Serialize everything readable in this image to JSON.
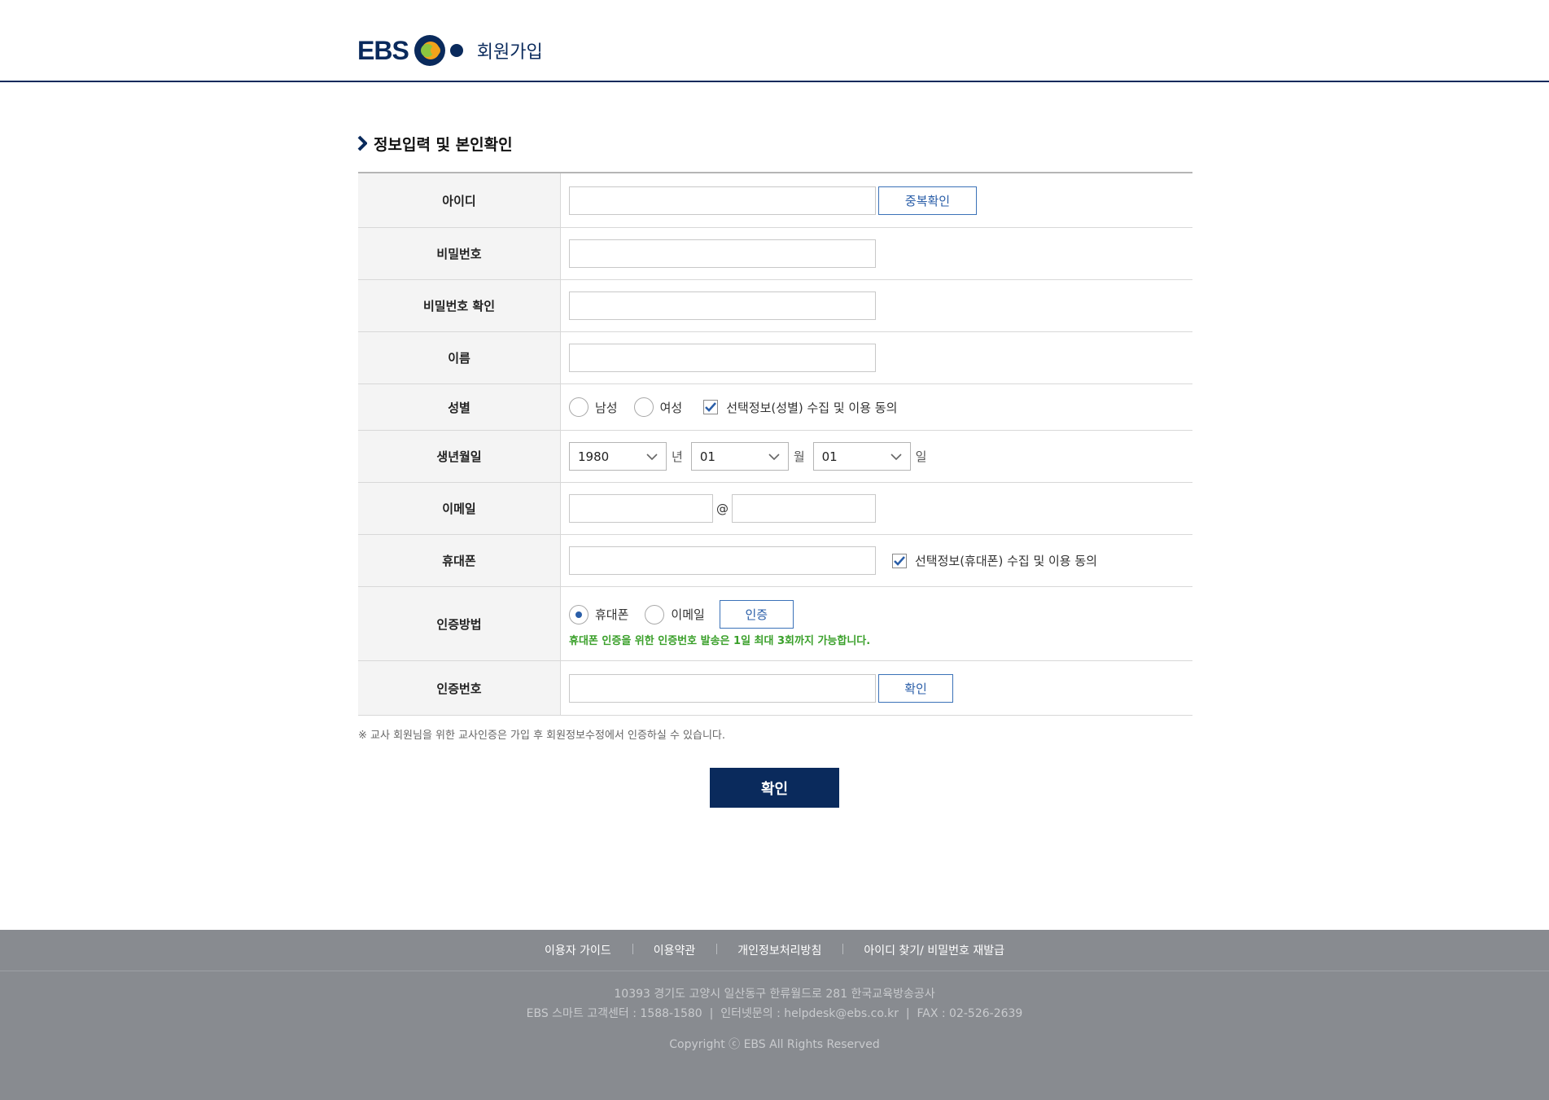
{
  "header": {
    "logo_text": "EBS",
    "subtitle": "회원가입"
  },
  "section": {
    "title": "정보입력 및 본인확인"
  },
  "form": {
    "id": {
      "label": "아이디",
      "value": "",
      "dup_check_label": "중복확인"
    },
    "password": {
      "label": "비밀번호",
      "value": ""
    },
    "password_confirm": {
      "label": "비밀번호 확인",
      "value": ""
    },
    "name": {
      "label": "이름",
      "value": ""
    },
    "gender": {
      "label": "성별",
      "options": [
        "남성",
        "여성"
      ],
      "selected": null,
      "consent_label": "선택정보(성별) 수집 및 이용 동의",
      "consent_checked": true
    },
    "birth": {
      "label": "생년월일",
      "year": "1980",
      "year_unit": "년",
      "month": "01",
      "month_unit": "월",
      "day": "01",
      "day_unit": "일"
    },
    "email": {
      "label": "이메일",
      "local": "",
      "at": "@",
      "domain": ""
    },
    "phone": {
      "label": "휴대폰",
      "value": "",
      "consent_label": "선택정보(휴대폰) 수집 및 이용 동의",
      "consent_checked": true
    },
    "auth_method": {
      "label": "인증방법",
      "options": [
        "휴대폰",
        "이메일"
      ],
      "selected": "휴대폰",
      "button_label": "인증",
      "notice": "휴대폰 인증을 위한 인증번호 발송은 1일 최대 3회까지 가능합니다."
    },
    "auth_code": {
      "label": "인증번호",
      "value": "",
      "confirm_label": "확인"
    }
  },
  "footnote": "※ 교사 회원님을 위한 교사인증은 가입 후 회원정보수정에서 인증하실 수 있습니다.",
  "submit_label": "확인",
  "footer": {
    "links": [
      "이용자 가이드",
      "이용약관",
      "개인정보처리방침",
      "아이디 찾기/ 비밀번호 재발급"
    ],
    "address": "10393 경기도 고양시 일산동구 한류월드로 281 한국교육방송공사",
    "contact": "EBS 스마트 고객센터 : 1588-1580  |  인터넷문의 : helpdesk@ebs.co.kr  |  FAX : 02-526-2639",
    "copyright": "Copyright ⓒ EBS All Rights Reserved"
  },
  "colors": {
    "brand_navy": "#0a2a5c",
    "button_blue": "#2a5ea8",
    "notice_green": "#3aa02a",
    "footer_gray": "#888b90"
  }
}
